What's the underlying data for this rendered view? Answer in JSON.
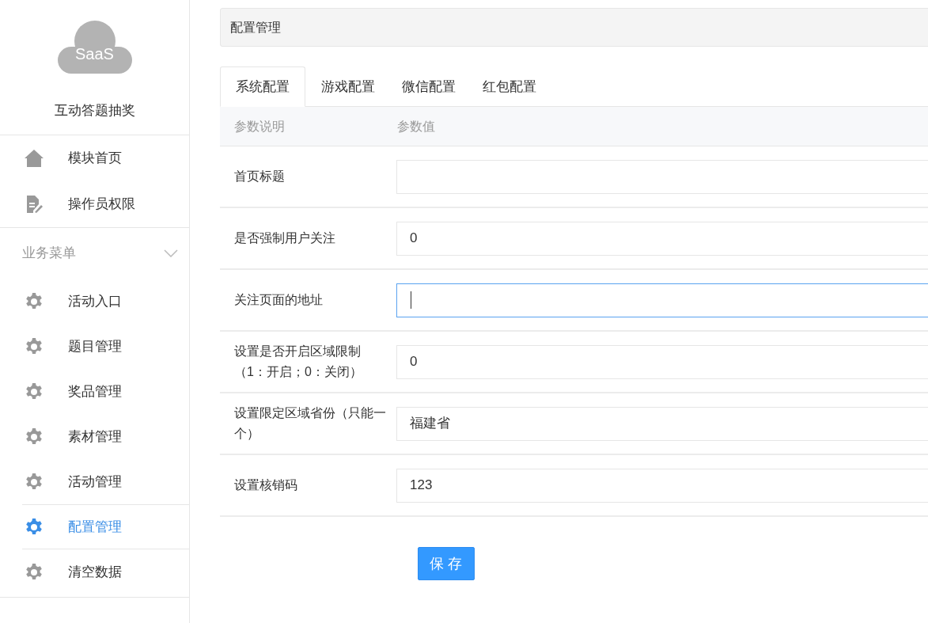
{
  "sidebar": {
    "logo_text": "SaaS",
    "app_title": "互动答题抽奖",
    "top_items": [
      {
        "label": "模块首页",
        "kind": "home"
      },
      {
        "label": "操作员权限",
        "kind": "doc"
      }
    ],
    "group": {
      "label": "业务菜单",
      "expanded": true,
      "items": [
        {
          "label": "活动入口",
          "selected": false
        },
        {
          "label": "题目管理",
          "selected": false
        },
        {
          "label": "奖品管理",
          "selected": false
        },
        {
          "label": "素材管理",
          "selected": false
        },
        {
          "label": "活动管理",
          "selected": false
        },
        {
          "label": "配置管理",
          "selected": true
        },
        {
          "label": "清空数据",
          "selected": false
        }
      ]
    }
  },
  "breadcrumb": "配置管理",
  "tabs": [
    {
      "label": "系统配置",
      "selected": true
    },
    {
      "label": "游戏配置",
      "selected": false
    },
    {
      "label": "微信配置",
      "selected": false
    },
    {
      "label": "红包配置",
      "selected": false
    }
  ],
  "table": {
    "columns": [
      "参数说明",
      "参数值"
    ],
    "rows": [
      {
        "label": "首页标题",
        "value": "",
        "focused": false
      },
      {
        "label": "是否强制用户关注",
        "value": "0",
        "focused": false
      },
      {
        "label": "关注页面的地址",
        "value": "",
        "focused": true
      },
      {
        "label": "设置是否开启区域限制（1：开启；0：关闭）",
        "value": "0",
        "focused": false
      },
      {
        "label": "设置限定区域省份（只能一个）",
        "value": "福建省",
        "focused": false
      },
      {
        "label": "设置核销码",
        "value": "123",
        "focused": false
      }
    ]
  },
  "save_button": "保 存"
}
